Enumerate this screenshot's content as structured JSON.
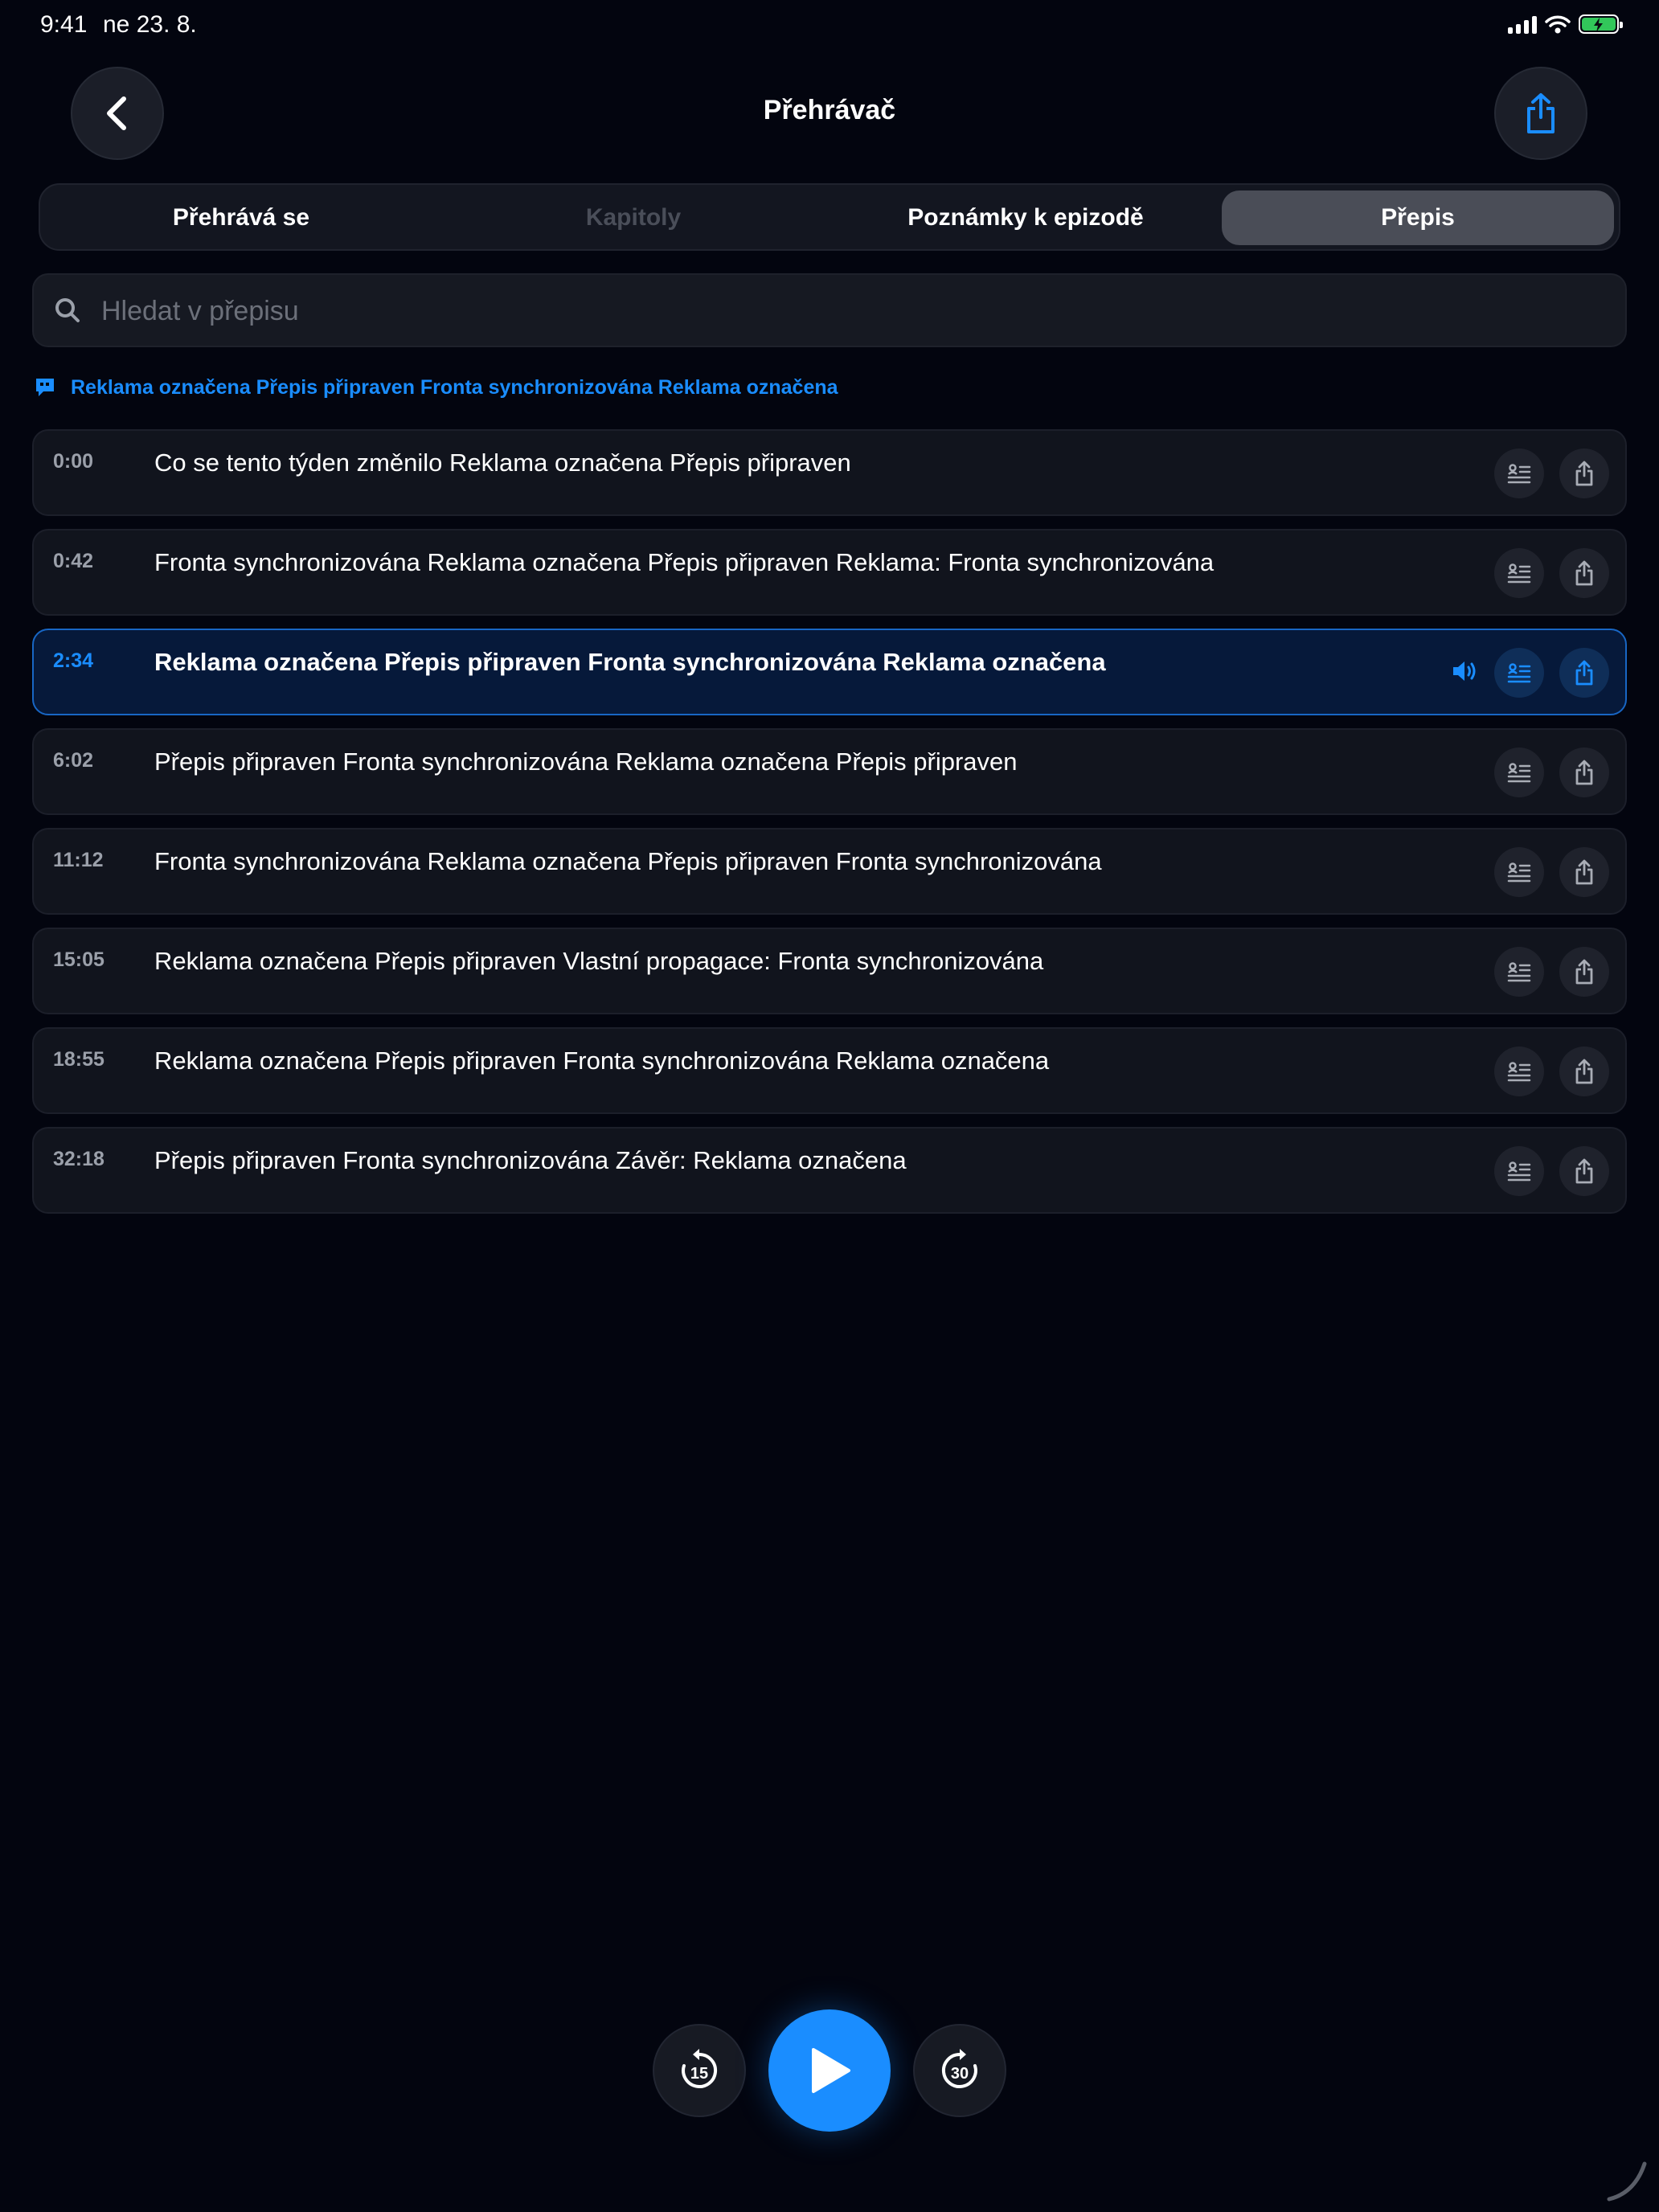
{
  "status": {
    "time": "9:41",
    "date": "ne 23. 8."
  },
  "header": {
    "title": "Přehrávač"
  },
  "tabs": [
    {
      "label": "Přehrává se",
      "state": "normal"
    },
    {
      "label": "Kapitoly",
      "state": "disabled"
    },
    {
      "label": "Poznámky k epizodě",
      "state": "normal"
    },
    {
      "label": "Přepis",
      "state": "active"
    }
  ],
  "search": {
    "placeholder": "Hledat v přepisu",
    "value": ""
  },
  "banner": {
    "text": "Reklama označena Přepis připraven Fronta synchronizována Reklama označena"
  },
  "transcript": [
    {
      "time": "0:00",
      "text": "Co se tento týden změnilo Reklama označena Přepis připraven"
    },
    {
      "time": "0:42",
      "text": "Fronta synchronizována Reklama označena Přepis připraven Reklama: Fronta synchronizována"
    },
    {
      "time": "2:34",
      "text": "Reklama označena Přepis připraven Fronta synchronizována Reklama označena"
    },
    {
      "time": "6:02",
      "text": "Přepis připraven Fronta synchronizována Reklama označena Přepis připraven"
    },
    {
      "time": "11:12",
      "text": "Fronta synchronizována Reklama označena Přepis připraven Fronta synchronizována"
    },
    {
      "time": "15:05",
      "text": "Reklama označena Přepis připraven Vlastní propagace: Fronta synchronizována"
    },
    {
      "time": "18:55",
      "text": "Reklama označena Přepis připraven Fronta synchronizována Reklama označena"
    },
    {
      "time": "32:18",
      "text": "Přepis připraven Fronta synchronizována Závěr: Reklama označena"
    }
  ],
  "active_row_index": 2,
  "controls": {
    "skip_back": "15",
    "skip_forward": "30"
  },
  "colors": {
    "accent": "#1a8dff",
    "background": "#03050f",
    "battery": "#32c75a"
  },
  "icons": [
    "back-chevron-icon",
    "share-icon",
    "search-icon",
    "transcript-bubble-icon",
    "bookmark-list-icon",
    "speaker-icon",
    "skip-back-icon",
    "play-icon",
    "skip-forward-icon"
  ]
}
